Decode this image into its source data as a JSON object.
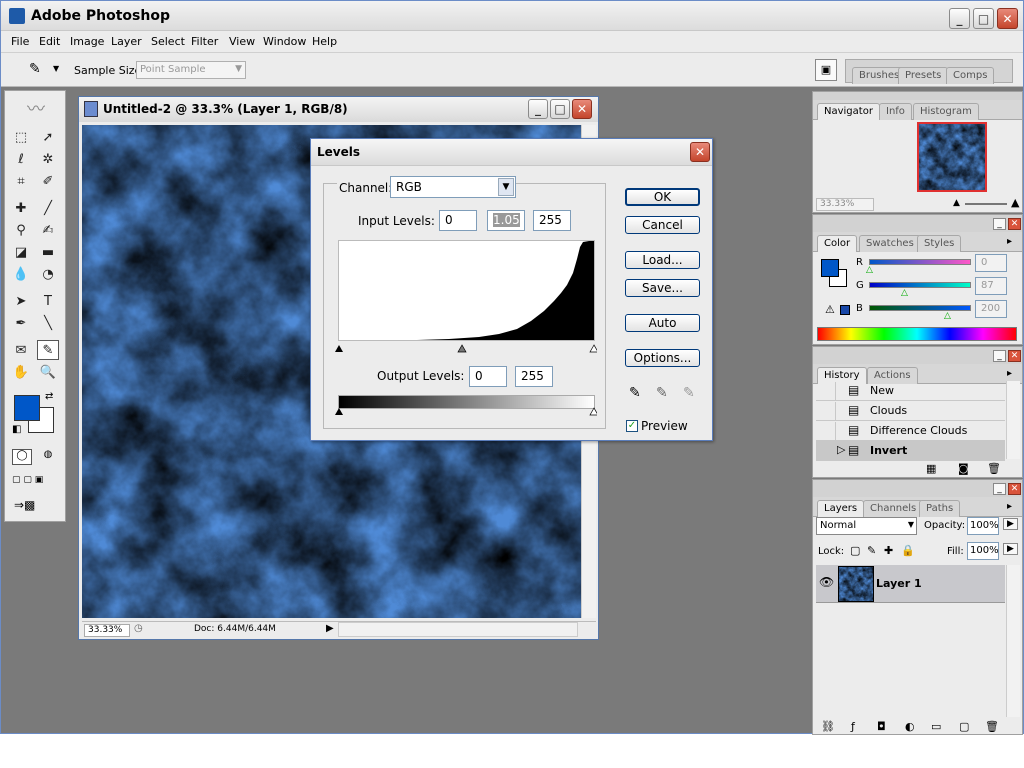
{
  "app": {
    "title": "Adobe Photoshop"
  },
  "menu": [
    "File",
    "Edit",
    "Image",
    "Layer",
    "Select",
    "Filter",
    "View",
    "Window",
    "Help"
  ],
  "options": {
    "sample_size_label": "Sample Size:",
    "sample_size_value": "Point Sample"
  },
  "well_tabs": [
    "Brushes",
    "Presets",
    "Comps"
  ],
  "document": {
    "title": "Untitled-2 @ 33.3% (Layer 1, RGB/8)",
    "zoom": "33.33%",
    "doc_info": "Doc: 6.44M/6.44M"
  },
  "levels": {
    "title": "Levels",
    "channel_label": "Channel:",
    "channel_value": "RGB",
    "input_label": "Input Levels:",
    "input_black": "0",
    "input_gamma": "1.05",
    "input_white": "255",
    "output_label": "Output Levels:",
    "output_black": "0",
    "output_white": "255",
    "buttons": {
      "ok": "OK",
      "cancel": "Cancel",
      "load": "Load...",
      "save": "Save...",
      "auto": "Auto",
      "options": "Options..."
    },
    "preview_label": "Preview",
    "preview_checked": true
  },
  "navigator": {
    "tabs": [
      "Navigator",
      "Info",
      "Histogram"
    ],
    "zoom": "33.33%"
  },
  "color": {
    "tabs": [
      "Color",
      "Swatches",
      "Styles"
    ],
    "r_label": "R",
    "g_label": "G",
    "b_label": "B",
    "r": "0",
    "g": "87",
    "b": "200",
    "fg_hex": "#0057c8"
  },
  "history": {
    "tabs": [
      "History",
      "Actions"
    ],
    "items": [
      "New",
      "Clouds",
      "Difference Clouds",
      "Invert"
    ],
    "active_index": 3
  },
  "layers": {
    "tabs": [
      "Layers",
      "Channels",
      "Paths"
    ],
    "blend_mode": "Normal",
    "opacity_label": "Opacity:",
    "opacity": "100%",
    "lock_label": "Lock:",
    "fill_label": "Fill:",
    "fill": "100%",
    "layer_name": "Layer 1"
  }
}
